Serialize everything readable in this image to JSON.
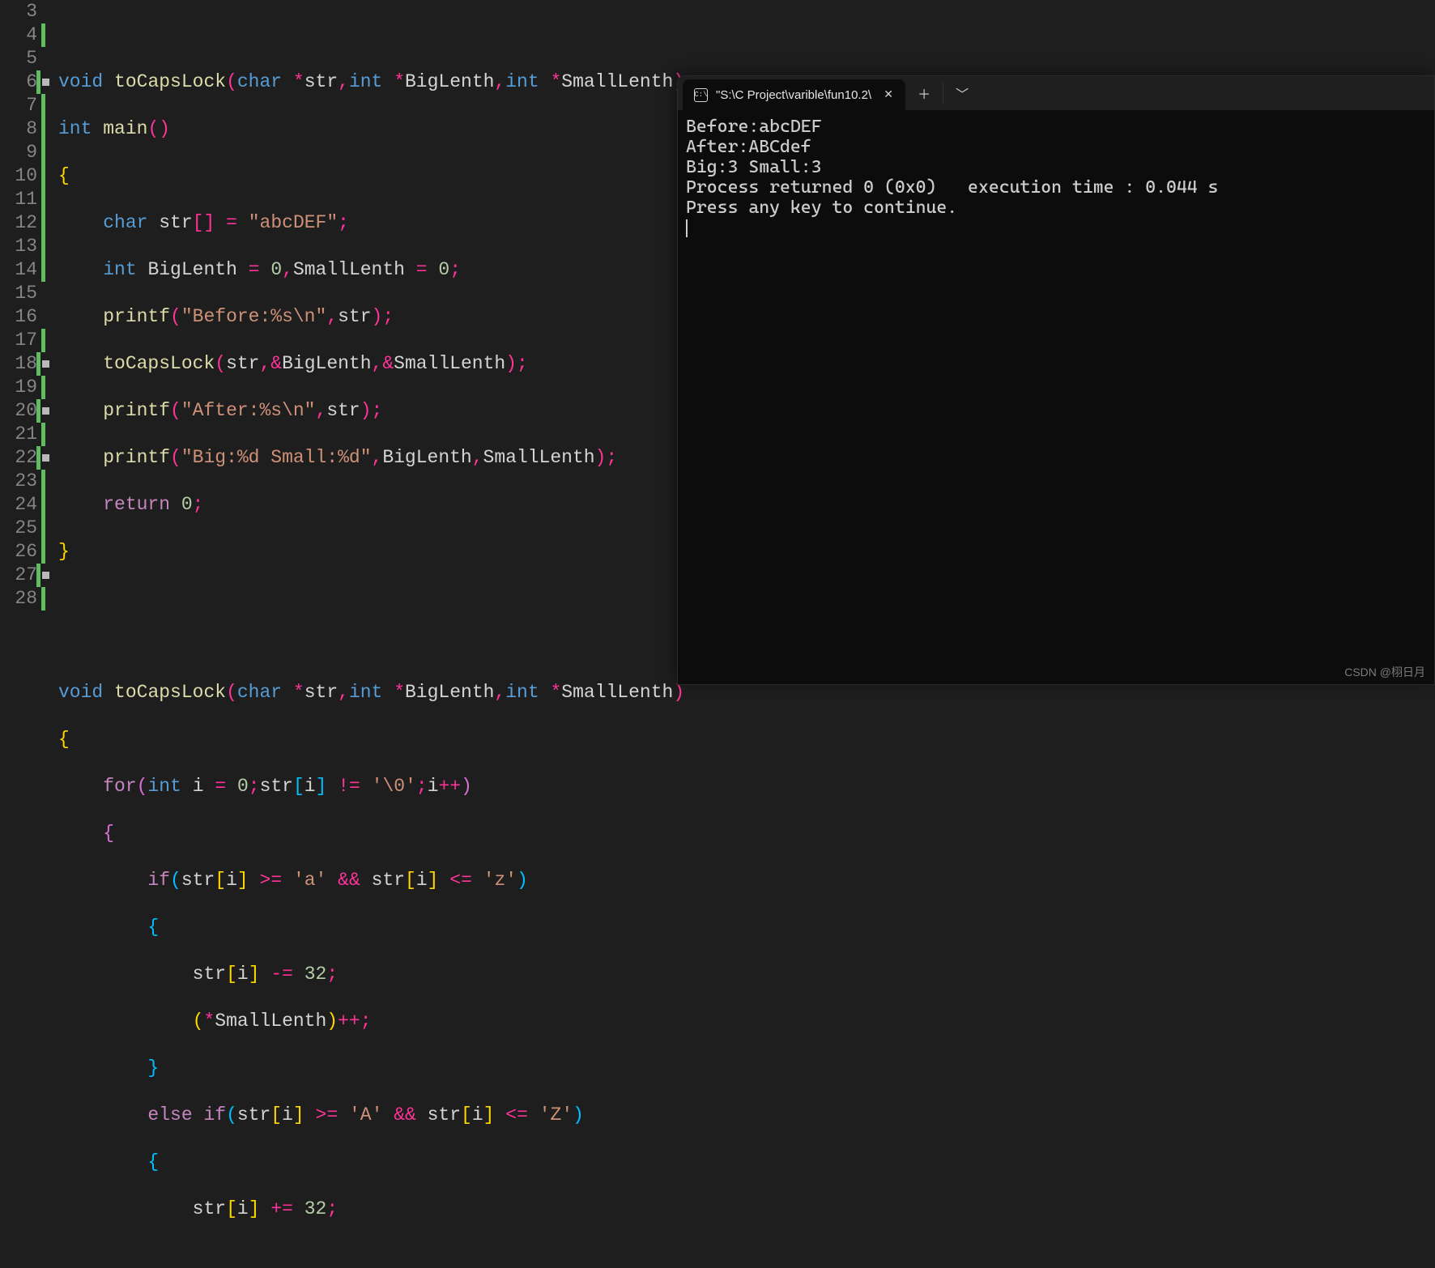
{
  "editor": {
    "lines": [
      3,
      4,
      5,
      6,
      7,
      8,
      9,
      10,
      11,
      12,
      13,
      14,
      15,
      16,
      17,
      18,
      19,
      20,
      21,
      22,
      23,
      24,
      25,
      26,
      27,
      28
    ],
    "code": {
      "l4_void": "void",
      "l4_fn": "toCapsLock",
      "l4_char": "char",
      "l4_star1": "*",
      "l4_str": "str",
      "l4_c1": ",",
      "l4_int1": "int",
      "l4_star2": "*",
      "l4_big": "BigLenth",
      "l4_c2": ",",
      "l4_int2": "int",
      "l4_star3": "*",
      "l4_small": "SmallLenth",
      "l4_semi": ";",
      "l5_int": "int",
      "l5_main": "main",
      "l7_char": "char",
      "l7_str": "str",
      "l7_eq": "=",
      "l7_lit": "\"abcDEF\"",
      "l7_semi": ";",
      "l8_int": "int",
      "l8_big": "BigLenth",
      "l8_eq1": "=",
      "l8_z1": "0",
      "l8_c": ",",
      "l8_small": "SmallLenth",
      "l8_eq2": "=",
      "l8_z2": "0",
      "l8_semi": ";",
      "l9_pf": "printf",
      "l9_lit": "\"Before:%s\\n\"",
      "l9_c": ",",
      "l9_str": "str",
      "l9_semi": ";",
      "l10_fn": "toCapsLock",
      "l10_str": "str",
      "l10_c1": ",",
      "l10_amp1": "&",
      "l10_big": "BigLenth",
      "l10_c2": ",",
      "l10_amp2": "&",
      "l10_small": "SmallLenth",
      "l10_semi": ";",
      "l11_pf": "printf",
      "l11_lit": "\"After:%s\\n\"",
      "l11_c": ",",
      "l11_str": "str",
      "l11_semi": ";",
      "l12_pf": "printf",
      "l12_lit": "\"Big:%d Small:%d\"",
      "l12_c1": ",",
      "l12_big": "BigLenth",
      "l12_c2": ",",
      "l12_small": "SmallLenth",
      "l12_semi": ";",
      "l13_ret": "return",
      "l13_z": "0",
      "l13_semi": ";",
      "l17_void": "void",
      "l17_fn": "toCapsLock",
      "l17_char": "char",
      "l17_star1": "*",
      "l17_str": "str",
      "l17_c1": ",",
      "l17_int1": "int",
      "l17_star2": "*",
      "l17_big": "BigLenth",
      "l17_c2": ",",
      "l17_int2": "int",
      "l17_star3": "*",
      "l17_small": "SmallLenth",
      "l19_for": "for",
      "l19_int": "int",
      "l19_i": "i",
      "l19_eq": "=",
      "l19_z": "0",
      "l19_semi1": ";",
      "l19_str": "str",
      "l19_i2": "i",
      "l19_ne": "!=",
      "l19_nul": "'\\0'",
      "l19_semi2": ";",
      "l19_i3": "i",
      "l19_inc": "++",
      "l21_if": "if",
      "l21_str1": "str",
      "l21_i1": "i",
      "l21_ge": ">=",
      "l21_a": "'a'",
      "l21_and": "&&",
      "l21_str2": "str",
      "l21_i2": "i",
      "l21_le": "<=",
      "l21_z": "'z'",
      "l23_str": "str",
      "l23_i": "i",
      "l23_me": "-=",
      "l23_n": "32",
      "l23_semi": ";",
      "l24_small": "SmallLenth",
      "l24_inc": "++",
      "l24_semi": ";",
      "l26_else": "else",
      "l26_if": "if",
      "l26_str1": "str",
      "l26_i1": "i",
      "l26_ge": ">=",
      "l26_A": "'A'",
      "l26_and": "&&",
      "l26_str2": "str",
      "l26_i2": "i",
      "l26_le": "<=",
      "l26_Z": "'Z'",
      "l28_str": "str",
      "l28_i": "i",
      "l28_pe": "+=",
      "l28_n": "32",
      "l28_semi": ";"
    }
  },
  "terminal": {
    "tab_title": "\"S:\\C Project\\varible\\fun10.2\\",
    "tab_icon_text": "C:\\",
    "output": [
      "Before:abcDEF",
      "After:ABCdef",
      "Big:3 Small:3",
      "Process returned 0 (0x0)   execution time : 0.044 s",
      "Press any key to continue."
    ]
  },
  "watermark": "CSDN @栩日月"
}
